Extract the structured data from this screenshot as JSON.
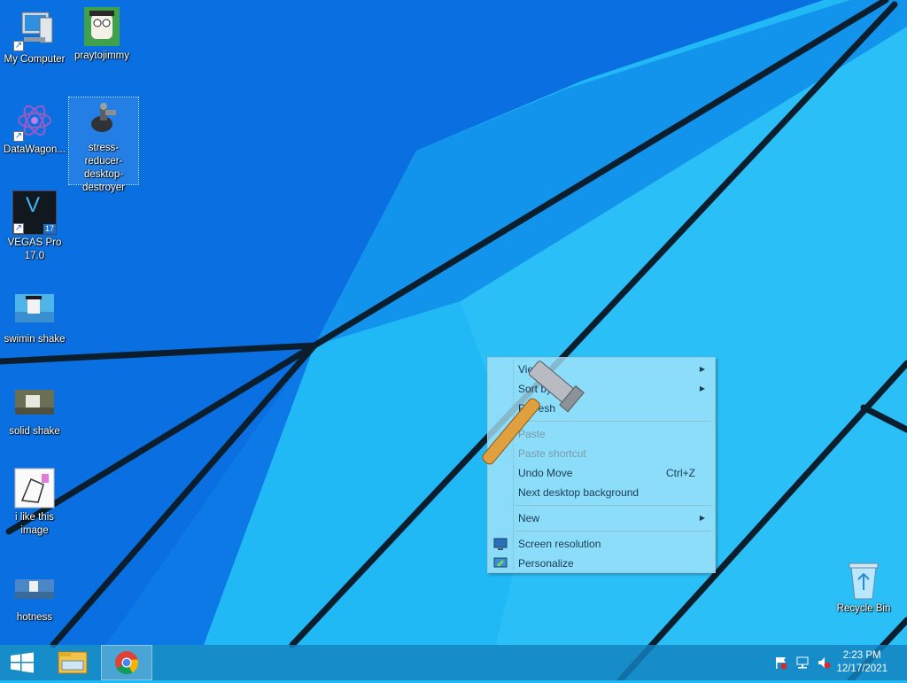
{
  "desktop": {
    "icons": [
      {
        "label": "My Computer",
        "shortcut": true
      },
      {
        "label": "praytojimmy",
        "shortcut": false
      },
      {
        "label": "DataWagon...",
        "shortcut": true
      },
      {
        "label": "stress-reducer-desktop-destroyer",
        "shortcut": false,
        "selected": true
      },
      {
        "label": "VEGAS Pro 17.0",
        "shortcut": true
      },
      {
        "label": "swimin shake",
        "shortcut": false
      },
      {
        "label": "solid shake",
        "shortcut": false
      },
      {
        "label": "i like this image",
        "shortcut": false
      },
      {
        "label": "hotness",
        "shortcut": false
      },
      {
        "label": "Recycle Bin",
        "shortcut": false
      }
    ],
    "vegas_badge": "17",
    "vegas_letter": "V"
  },
  "context_menu": {
    "items": [
      {
        "label": "View",
        "submenu": true,
        "enabled": true
      },
      {
        "label": "Sort by",
        "submenu": true,
        "enabled": true
      },
      {
        "label": "Refresh",
        "submenu": false,
        "enabled": true
      },
      {
        "label": "Paste",
        "submenu": false,
        "enabled": false
      },
      {
        "label": "Paste shortcut",
        "submenu": false,
        "enabled": false
      },
      {
        "label": "Undo Move",
        "shortcut": "Ctrl+Z",
        "enabled": true
      },
      {
        "label": "Next desktop background",
        "enabled": true
      },
      {
        "label": "New",
        "submenu": true,
        "enabled": true
      },
      {
        "label": "Screen resolution",
        "icon": "monitor-icon",
        "enabled": true
      },
      {
        "label": "Personalize",
        "icon": "personalize-icon",
        "enabled": true
      }
    ],
    "submenu_arrow": "▶"
  },
  "taskbar": {
    "start_icon": "windows-logo-icon",
    "pinned": [
      "file-explorer-icon",
      "chrome-icon"
    ],
    "tray": [
      "action-center-flag-icon",
      "network-icon",
      "volume-muted-icon"
    ],
    "time": "2:23 PM",
    "date": "12/17/2021"
  },
  "colors": {
    "wallpaper_light": "#21b9f5",
    "wallpaper_dark": "#0a6fe0",
    "wallpaper_lines": "#0a1e2e",
    "taskbar": "#1482be"
  }
}
